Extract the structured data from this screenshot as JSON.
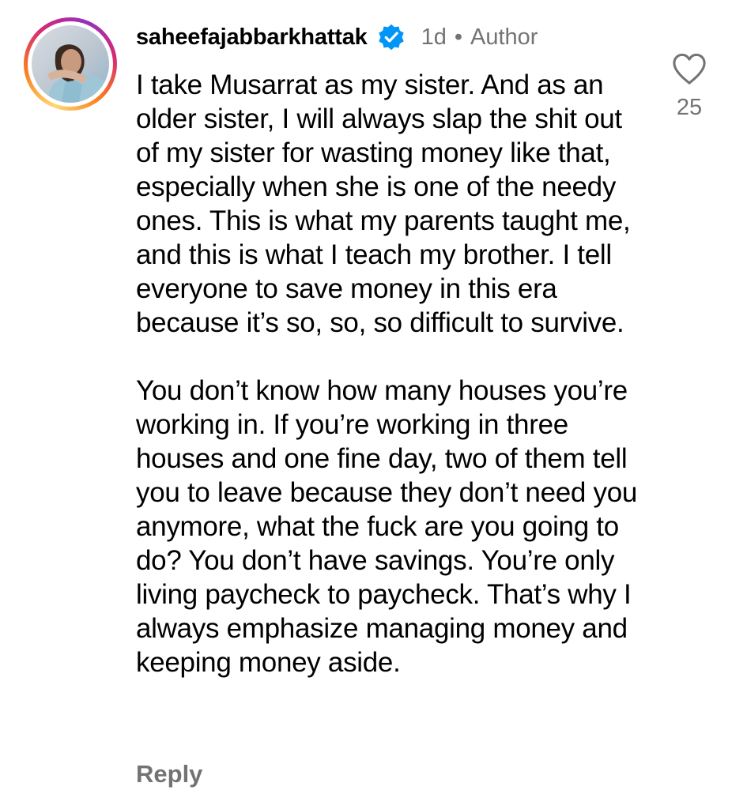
{
  "comment": {
    "username": "saheefajabbarkhattak",
    "verified_icon": "verified-badge-icon",
    "time": "1d",
    "separator": "•",
    "author_label": "Author",
    "paragraphs": [
      "I take Musarrat as my sister. And as an older sister, I will always slap the shit out of my sister for wasting money like that, especially when she is one of the needy ones. This is what my parents taught me, and this is what I teach my brother. I tell everyone to save money in this era because it’s so, so, so difficult to survive.",
      "You don’t know how many houses you’re working in. If you’re working in three houses and one fine day, two of them tell you to leave because they don’t need you anymore, what the fuck are you going to do? You don’t have savings. You’re only living paycheck to paycheck. That’s why I always emphasize managing money and keeping money aside."
    ],
    "like_icon": "heart-icon",
    "like_count": "25",
    "reply_label": "Reply"
  },
  "colors": {
    "text": "#000000",
    "secondary": "#737373",
    "verified": "#0095f6"
  }
}
